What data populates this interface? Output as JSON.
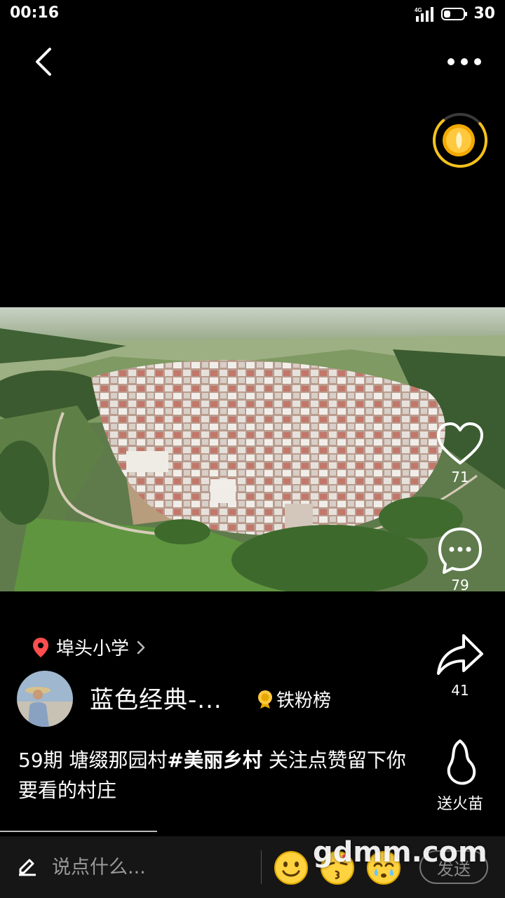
{
  "status_bar": {
    "time": "00:16",
    "network": "4G",
    "battery_level": "30"
  },
  "header": {
    "back_icon": "chevron-left-icon",
    "more_icon": "ellipsis-icon"
  },
  "coin_widget": {
    "icon": "gold-coin-icon",
    "accent": "#f5c21b",
    "progress": 0.75
  },
  "video": {
    "scene": "aerial-village-photo"
  },
  "actions": {
    "like": {
      "icon": "heart-outline-icon",
      "count": "71"
    },
    "comment": {
      "icon": "comment-bubble-icon",
      "count": "79"
    },
    "share": {
      "icon": "share-arrow-icon",
      "count": "41"
    },
    "gift": {
      "icon": "flame-sprout-icon",
      "label": "送火苗"
    }
  },
  "location": {
    "icon": "location-pin-icon",
    "text": "埠头小学",
    "color": "#ff4d4f"
  },
  "author": {
    "name": "蓝色经典-...",
    "badge_icon": "medal-icon",
    "fan_rank": "铁粉榜"
  },
  "caption": {
    "prefix": "59期 塘缀那园村",
    "tag": "#美丽乡村",
    "suffix": " 关注点赞留下你要看的村庄"
  },
  "comment_bar": {
    "edit_icon": "pencil-icon",
    "placeholder": "说点什么...",
    "emojis": [
      "smile-emoji-icon",
      "kiss-emoji-icon",
      "cry-emoji-icon"
    ],
    "send_label": "发送"
  },
  "watermark": "gdmm.com"
}
